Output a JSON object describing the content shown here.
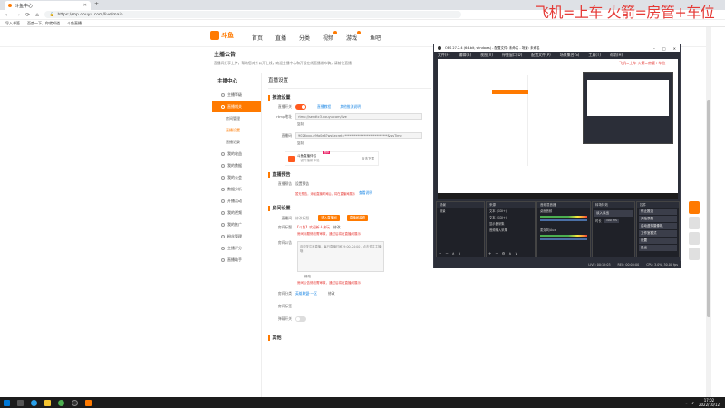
{
  "browser": {
    "tab_title": "斗鱼中心",
    "url": "https://mp.douyu.com/live/main",
    "bookmarks": [
      "导入书签",
      "百度一下，你就知道",
      "斗鱼直播"
    ]
  },
  "overlay_text": "飞机=上车 火箭=房管+车位",
  "site": {
    "logo_text": "斗鱼",
    "nav": [
      {
        "label": "首页",
        "badge": false
      },
      {
        "label": "直播",
        "badge": false
      },
      {
        "label": "分类",
        "badge": false
      },
      {
        "label": "视频",
        "badge": true
      },
      {
        "label": "游戏",
        "badge": true
      },
      {
        "label": "鱼吧",
        "badge": false
      }
    ]
  },
  "notice": {
    "title": "主播公告",
    "text": "直播间分享上传，帮助您对外公开上线，欢迎主播中心和开设在线直播发布稿，请前往直播"
  },
  "sidebar": {
    "title": "主播中心",
    "items": [
      {
        "label": "主播等级",
        "active": false
      },
      {
        "label": "直播相关",
        "active": true,
        "children": [
          {
            "label": "房间管理",
            "current": false
          },
          {
            "label": "直播设置",
            "current": true
          },
          {
            "label": "直播记录",
            "current": false
          }
        ]
      },
      {
        "label": "我的收益",
        "active": false
      },
      {
        "label": "我的数据",
        "active": false
      },
      {
        "label": "我的公会",
        "active": false
      },
      {
        "label": "数据分析",
        "active": false
      },
      {
        "label": "开播活动",
        "active": false
      },
      {
        "label": "我的视频",
        "active": false
      },
      {
        "label": "我的推广",
        "active": false
      },
      {
        "label": "粉丝管理",
        "active": false
      },
      {
        "label": "主播评分",
        "active": false
      },
      {
        "label": "直播助手",
        "active": false
      }
    ]
  },
  "main": {
    "title": "直播设置",
    "stream": {
      "section": "推流设置",
      "toggle_label": "直播开关",
      "link1": "直播教程",
      "link2": "其他推流说明",
      "rtmp_label": "rtmp地址",
      "rtmp_value": "rtmp://sendtc3.douyu.com/live",
      "copy1": "复制",
      "key_label": "直播码",
      "key_value": "9026xxx-e9fa0e6?wsSecret=***************************&wsTime",
      "copy2": "复制",
      "card_title": "斗鱼直播伴侣",
      "card_sub": "一键开播新体验",
      "card_btn": "点击下载",
      "card_tag": "推荐"
    },
    "preview": {
      "section": "直播预告",
      "label": "直播预告",
      "value": "设置预告",
      "note": "暂无预告，添加直播时间后，将在直播间展示",
      "link": "查看说明"
    },
    "room": {
      "section": "房间设置",
      "label1": "直播间",
      "value1": "修改标题",
      "btn1": "进入直播间",
      "btn2": "直播间装修",
      "label2": "房间标题",
      "value2": "【斗鱼】欢迎新人来玩",
      "link2": "修改",
      "note2": "房间标题修改需审核，通过后将在直播间展示",
      "label3": "房间公告",
      "notice_text": "欢迎关注我直播，每日直播时间19:00-24:00，点击关注主播哦",
      "copy3": "修改",
      "note3": "房间公告修改需审核，通过后将在直播间展示",
      "label4": "房间分类",
      "value4": "英雄联盟·一区",
      "link4": "修改",
      "label5": "房间标签",
      "label6": "弹幕开关"
    },
    "other": {
      "section": "其他"
    }
  },
  "obs": {
    "title": "OBS 27.2.4 (64-bit, windows) - 配置文件: 未命名 - 场景: 未命名",
    "menu": [
      "文件(F)",
      "编辑(E)",
      "视图(V)",
      "停靠窗口(D)",
      "配置文件(P)",
      "场景集合(S)",
      "工具(T)",
      "帮助(H)"
    ],
    "panels": {
      "scenes": {
        "title": "场景",
        "items": [
          "场景"
        ]
      },
      "sources": {
        "title": "来源",
        "items": [
          "文本 (GDI+)",
          "文本 (GDI+)",
          "显示器采集",
          "音频输入采集"
        ]
      },
      "mixer": {
        "title": "音频混音器",
        "tracks": [
          "桌面音频",
          "麦克风/Aux"
        ]
      },
      "transitions": {
        "title": "转场特效",
        "value": "淡入淡出",
        "duration_label": "时长",
        "duration": "300 ms"
      },
      "controls": {
        "title": "控件",
        "buttons": [
          "停止推流",
          "开始录制",
          "启动虚拟摄像机",
          "工作室模式",
          "设置",
          "退出"
        ]
      }
    },
    "status": {
      "live": "LIVE: 00:12:03",
      "rec": "REC: 00:00:00",
      "cpu": "CPU: 3.0%, 30.00 fps"
    },
    "mini_overlay": "飞机=上车 火箭=房管+车位"
  },
  "taskbar": {
    "time": "17:02",
    "date": "2022/10/12"
  }
}
